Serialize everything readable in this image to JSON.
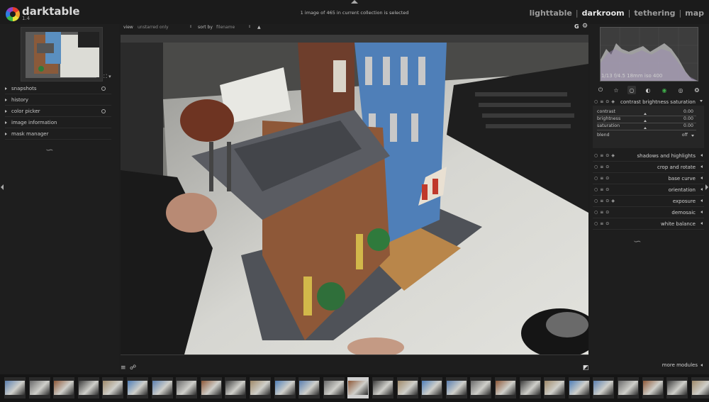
{
  "app": {
    "name": "darktable",
    "version": "1.4"
  },
  "header": {
    "selection_status": "1 image of 465 in current collection is selected",
    "views": [
      {
        "label": "lighttable",
        "active": false
      },
      {
        "label": "darkroom",
        "active": true
      },
      {
        "label": "tethering",
        "active": false
      },
      {
        "label": "map",
        "active": false
      }
    ],
    "separator": "|"
  },
  "navigation": {
    "zoom_label": "⛶ ▾"
  },
  "left_panel": {
    "items": [
      {
        "label": "snapshots",
        "has_reset": true
      },
      {
        "label": "history",
        "has_reset": false
      },
      {
        "label": "color picker",
        "has_reset": true
      },
      {
        "label": "image information",
        "has_reset": false
      },
      {
        "label": "mask manager",
        "has_reset": false
      }
    ],
    "squiggle": "∽"
  },
  "center_bar": {
    "view_label": "view",
    "view_value": "unstarred only",
    "sort_label": "sort by",
    "sort_value": "filename",
    "sort_dir": "▲",
    "grouping": "G",
    "settings": "⚙"
  },
  "bottom_toolbar": {
    "presets": "≡",
    "styles": "☍",
    "overexposed": "◩"
  },
  "histogram": {
    "info": "1/13 f/4.5 18mm iso 400"
  },
  "module_groups": [
    "⏻",
    "☆",
    "○",
    "◐",
    "◉",
    "◎",
    "❂"
  ],
  "expanded_module": {
    "title": "contrast brightness saturation",
    "sliders": [
      {
        "label": "contrast",
        "value": "0.00"
      },
      {
        "label": "brightness",
        "value": "0.00"
      },
      {
        "label": "saturation",
        "value": "0.00"
      }
    ],
    "blend": {
      "label": "blend",
      "value": "off"
    }
  },
  "modules": [
    {
      "label": "shadows and highlights",
      "presets": true
    },
    {
      "label": "crop and rotate",
      "presets": false
    },
    {
      "label": "base curve",
      "presets": false
    },
    {
      "label": "orientation",
      "presets": false
    },
    {
      "label": "exposure",
      "presets": true
    },
    {
      "label": "demosaic",
      "presets": false
    },
    {
      "label": "white balance",
      "presets": false
    }
  ],
  "more_modules": "more modules",
  "right_squiggle": "∽",
  "filmstrip": {
    "count": 30,
    "selected_index": 14
  },
  "colors": {
    "accent": "#e6e6e6",
    "panel": "#1e1e1e",
    "center": "#3b3b3b"
  }
}
